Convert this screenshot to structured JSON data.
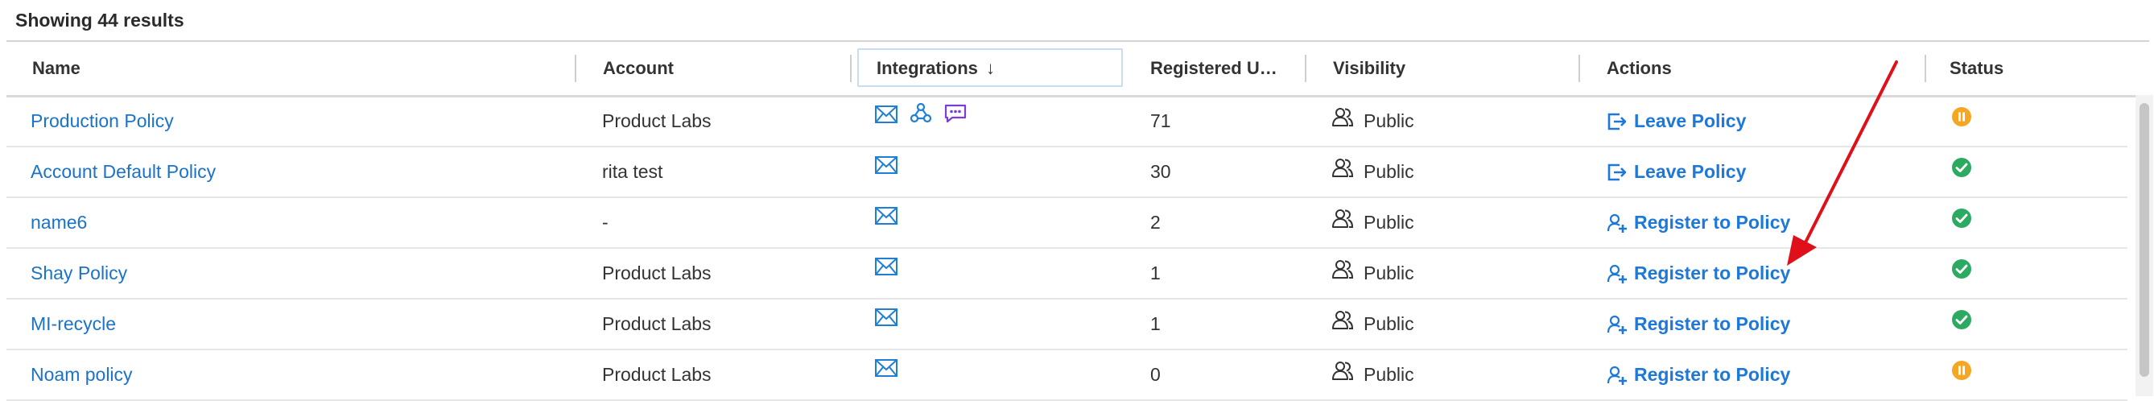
{
  "summary": "Showing 44 results",
  "headers": {
    "name": "Name",
    "account": "Account",
    "integrations": "Integrations",
    "sort_indicator": "↓",
    "registered": "Registered U…",
    "visibility": "Visibility",
    "actions": "Actions",
    "status": "Status"
  },
  "rows": [
    {
      "name": "Production Policy",
      "account": "Product Labs",
      "integrations": [
        "email-icon",
        "webhook-icon",
        "chat-icon"
      ],
      "registered": "71",
      "visibility": "Public",
      "action": "Leave Policy",
      "action_icon": "leave-icon",
      "status": "paused"
    },
    {
      "name": "Account Default Policy",
      "account": "rita test",
      "integrations": [
        "email-icon"
      ],
      "registered": "30",
      "visibility": "Public",
      "action": "Leave Policy",
      "action_icon": "leave-icon",
      "status": "active"
    },
    {
      "name": "name6",
      "account": "-",
      "integrations": [
        "email-icon"
      ],
      "registered": "2",
      "visibility": "Public",
      "action": "Register to Policy",
      "action_icon": "add-user-icon",
      "status": "active"
    },
    {
      "name": "Shay Policy",
      "account": "Product Labs",
      "integrations": [
        "email-icon"
      ],
      "registered": "1",
      "visibility": "Public",
      "action": "Register to Policy",
      "action_icon": "add-user-icon",
      "status": "active"
    },
    {
      "name": "MI-recycle",
      "account": "Product Labs",
      "integrations": [
        "email-icon"
      ],
      "registered": "1",
      "visibility": "Public",
      "action": "Register to Policy",
      "action_icon": "add-user-icon",
      "status": "active"
    },
    {
      "name": "Noam policy",
      "account": "Product Labs",
      "integrations": [
        "email-icon"
      ],
      "registered": "0",
      "visibility": "Public",
      "action": "Register to Policy",
      "action_icon": "add-user-icon",
      "status": "paused"
    }
  ],
  "colors": {
    "link": "#1a73c8",
    "action": "#1d78d8",
    "status_active": "#2daa62",
    "status_paused": "#f5a623",
    "annotation_arrow": "#e0101a",
    "chat_icon": "#7a3ed6"
  }
}
